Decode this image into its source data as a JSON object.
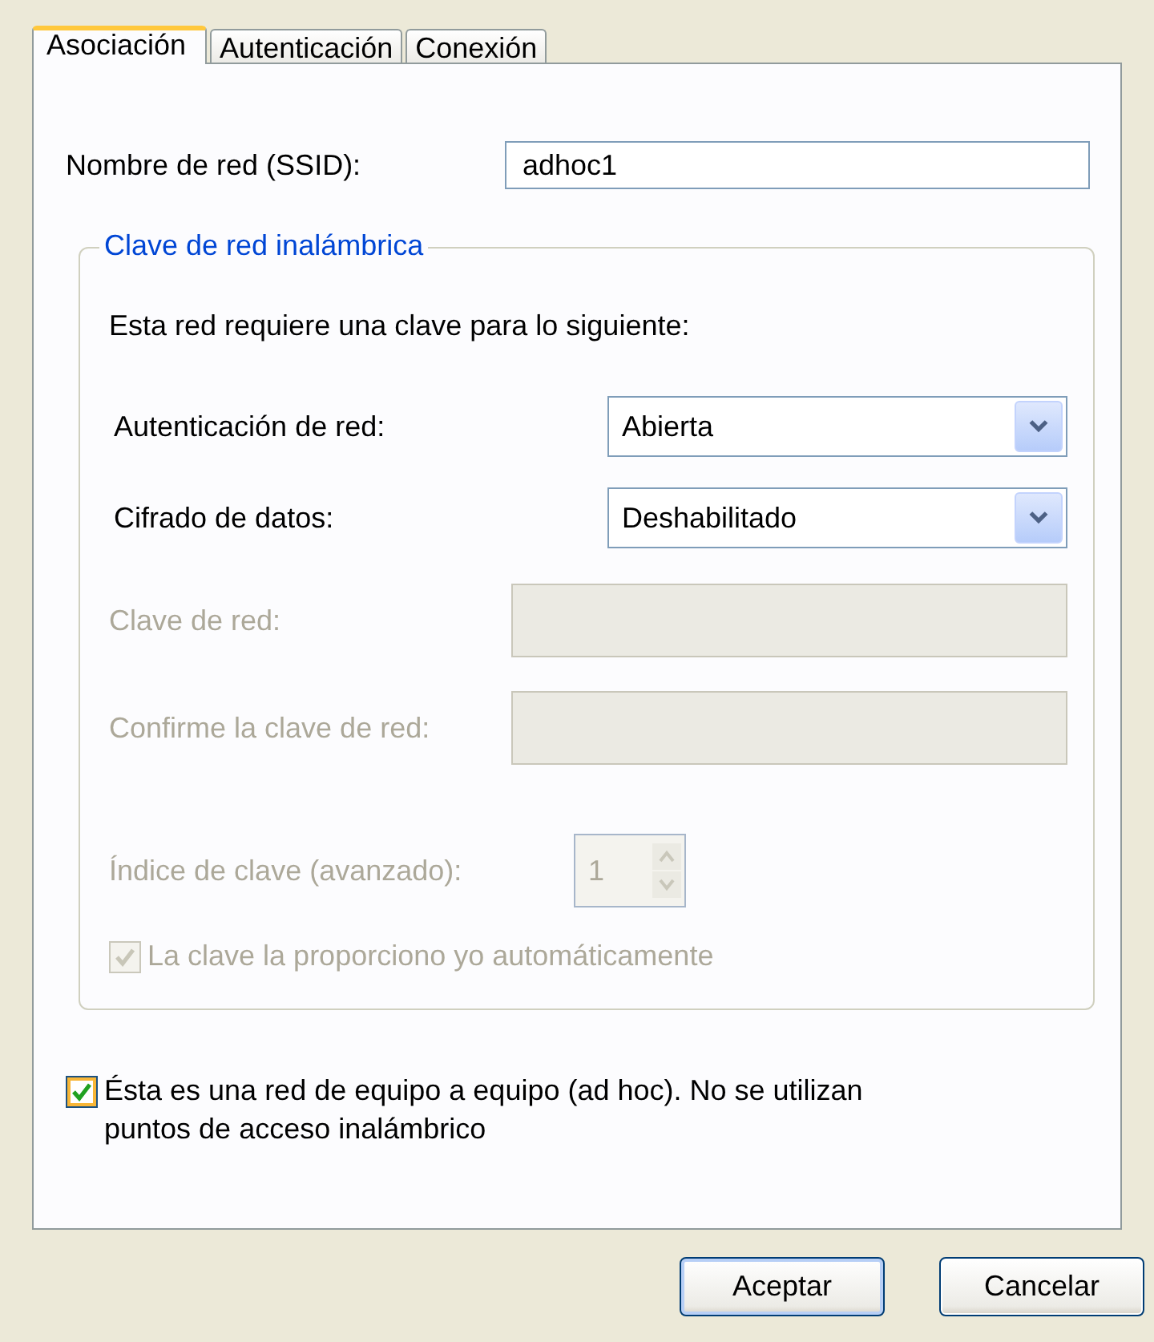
{
  "tabs": [
    {
      "label": "Asociación",
      "selected": true
    },
    {
      "label": "Autenticación",
      "selected": false
    },
    {
      "label": "Conexión",
      "selected": false
    }
  ],
  "ssid": {
    "label": "Nombre de red (SSID):",
    "value": "adhoc1"
  },
  "group": {
    "title": "Clave de red inalámbrica",
    "intro": "Esta red requiere una clave para lo siguiente:",
    "fields": [
      {
        "kind": "combo",
        "label": "Autenticación de red:",
        "value": "Abierta",
        "disabled": false
      },
      {
        "kind": "combo",
        "label": "Cifrado de datos:",
        "value": "Deshabilitado",
        "disabled": false
      },
      {
        "kind": "text",
        "label": "Clave de red:",
        "disabled": true
      },
      {
        "kind": "text",
        "label": "Confirme la clave de red:",
        "disabled": true
      },
      {
        "kind": "spinner",
        "label": "Índice de clave (avanzado):",
        "value": "1",
        "disabled": true
      },
      {
        "kind": "checkbox",
        "label": "La clave la proporciono yo automáticamente",
        "checked": true,
        "disabled": true
      }
    ]
  },
  "adhoc": {
    "label": "Ésta es una red de equipo a equipo (ad hoc). No se utilizan puntos de acceso inalámbrico",
    "checked": true
  },
  "buttons": [
    {
      "label": "Aceptar",
      "default": true
    },
    {
      "label": "Cancelar",
      "default": false
    }
  ]
}
